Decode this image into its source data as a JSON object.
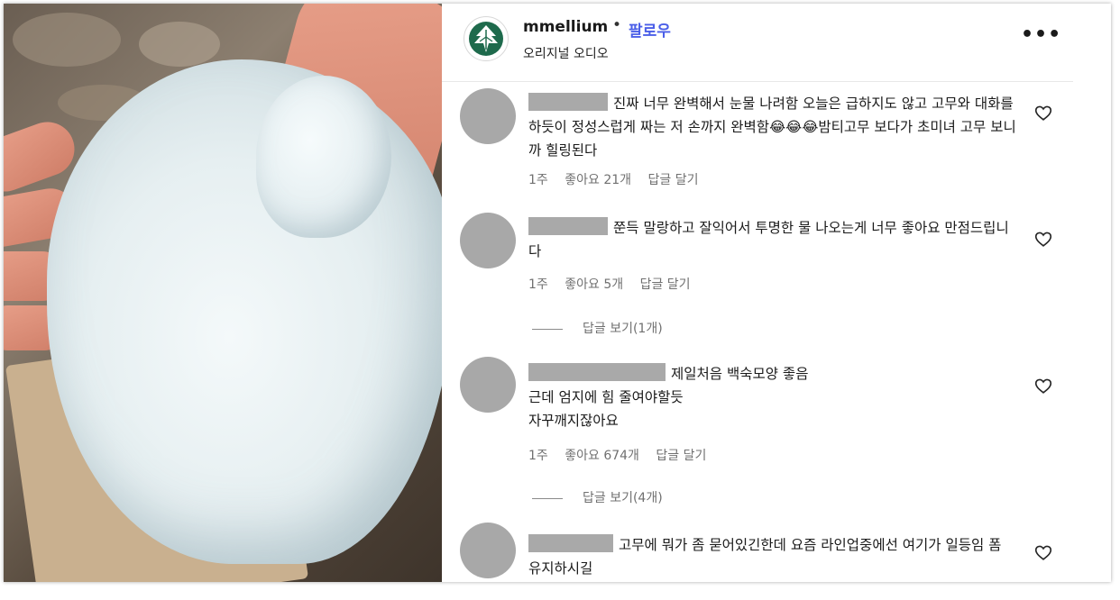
{
  "post": {
    "username": "mmellium",
    "separator": "•",
    "follow_label": "팔로우",
    "audio_label": "오리지널 오디오",
    "more_label": "•••"
  },
  "comments": [
    {
      "text": "진짜 너무 완벽해서 눈물 나려함 오늘은 급하지도 않고 고무와 대화를 하듯이 정성스럽게 짜는 저 손까지 완벽함😂😂😂밤티고무 보다가 초미녀 고무 보니까 힐링된다",
      "time": "1주",
      "likes": "좋아요 21개",
      "reply": "답글 달기"
    },
    {
      "text": "쭌득 말랑하고 잘익어서 투명한 물 나오는게 너무 좋아요 만점드립니다",
      "time": "1주",
      "likes": "좋아요 5개",
      "reply": "답글 달기",
      "view_replies": "답글 보기(1개)"
    },
    {
      "line1": "제일처음 백숙모양 좋음",
      "line2": "근데 엄지에 힘 줄여야할듯",
      "line3": "자꾸깨지잖아요",
      "time": "1주",
      "likes": "좋아요 674개",
      "reply": "답글 달기",
      "view_replies": "답글 보기(4개)"
    },
    {
      "text": "고무에 뭐가 좀 묻어있긴한데 요즘 라인업중에선 여기가 일등임 폼 유지하시길"
    }
  ],
  "colors": {
    "follow": "#4a5ee8",
    "meta": "#707070",
    "redaction": "#a9a9a9",
    "logo": "#1e6a4c"
  },
  "icons": [
    "leaf-logo-icon",
    "more-options-icon",
    "heart-icon"
  ]
}
